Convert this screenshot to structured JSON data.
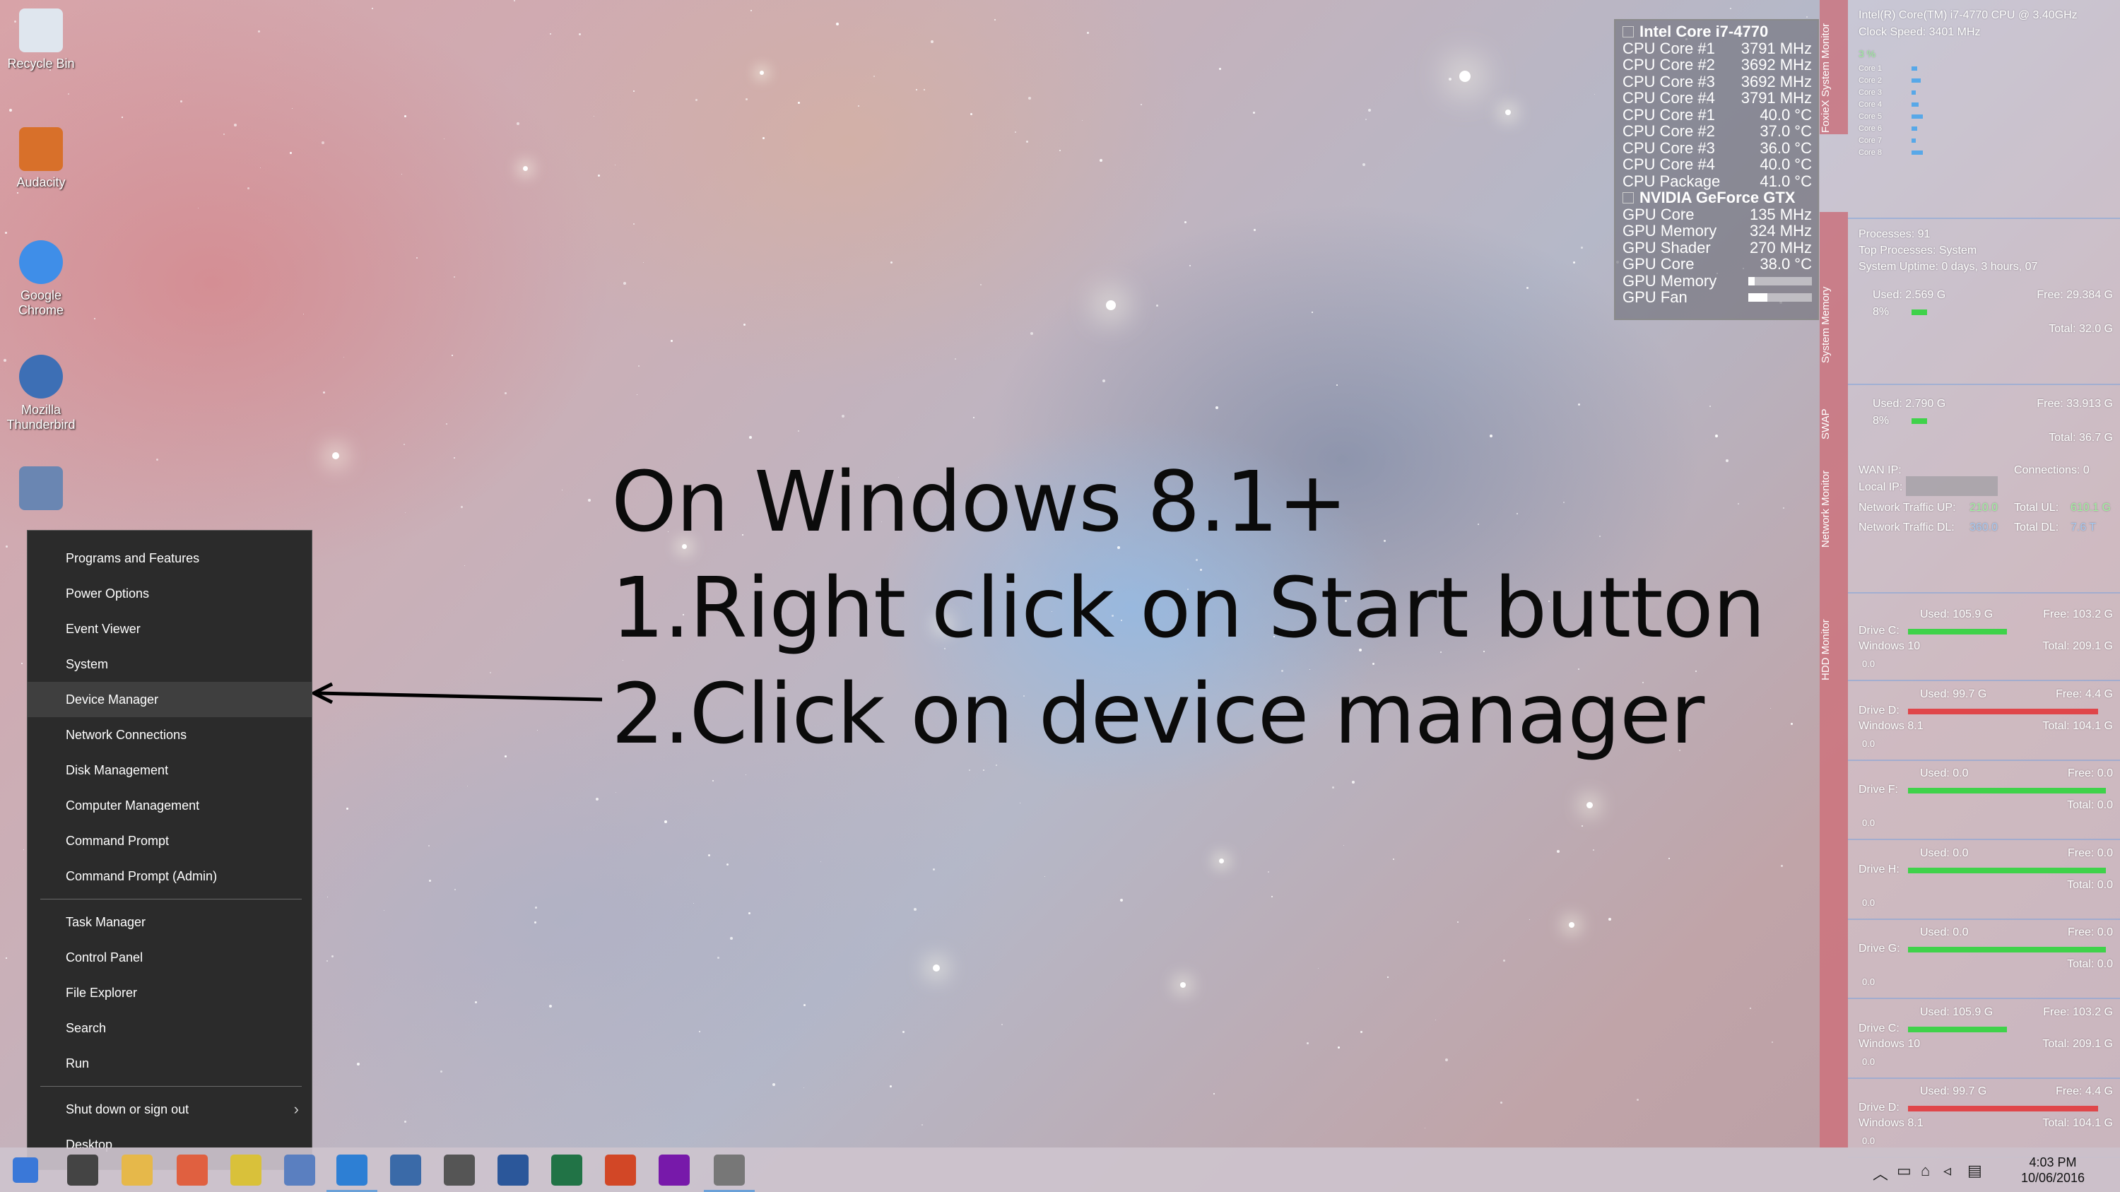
{
  "desktop_icons": [
    {
      "label": "Recycle Bin",
      "color": "#dfe6ee"
    },
    {
      "label": "Audacity",
      "color": "#d8702a"
    },
    {
      "label": "Google Chrome",
      "color": "#3f8ee8"
    },
    {
      "label": "Mozilla Thunderbird",
      "color": "#3d6fb5"
    },
    {
      "label": "",
      "color": "#6a86b2"
    }
  ],
  "instructions": {
    "line1": "On Windows 8.1+",
    "line2": "1.Right click on Start button",
    "line3": "2.Click on device manager"
  },
  "context_menu": {
    "group1": [
      "Programs and Features",
      "Power Options",
      "Event Viewer",
      "System",
      "Device Manager",
      "Network Connections",
      "Disk Management",
      "Computer Management",
      "Command Prompt",
      "Command Prompt (Admin)"
    ],
    "group2": [
      "Task Manager",
      "Control Panel",
      "File Explorer",
      "Search",
      "Run"
    ],
    "group3": {
      "shutdown": "Shut down or sign out",
      "chevron": "›",
      "desktop": "Desktop"
    },
    "highlighted": "Device Manager"
  },
  "gadget": {
    "cpu_title": "Intel Core i7-4770",
    "cpu_rows": [
      [
        "CPU Core #1",
        "3791 MHz"
      ],
      [
        "CPU Core #2",
        "3692 MHz"
      ],
      [
        "CPU Core #3",
        "3692 MHz"
      ],
      [
        "CPU Core #4",
        "3791 MHz"
      ],
      [
        "CPU Core #1",
        "40.0 °C"
      ],
      [
        "CPU Core #2",
        "37.0 °C"
      ],
      [
        "CPU Core #3",
        "36.0 °C"
      ],
      [
        "CPU Core #4",
        "40.0 °C"
      ],
      [
        "CPU Package",
        "41.0 °C"
      ]
    ],
    "gpu_title": "NVIDIA GeForce GTX",
    "gpu_rows": [
      [
        "GPU Core",
        "135 MHz"
      ],
      [
        "GPU Memory",
        "324 MHz"
      ],
      [
        "GPU Shader",
        "270 MHz"
      ],
      [
        "GPU Core",
        "38.0 °C"
      ]
    ],
    "gpu_bars": [
      {
        "label": "GPU Memory",
        "fill": 0.1
      },
      {
        "label": "GPU Fan",
        "fill": 0.3
      }
    ]
  },
  "monitor": {
    "cpu_name": "Intel(R) Core(TM) i7-4770 CPU @ 3.40GHz",
    "clock": "Clock Speed: 3401 MHz",
    "cpu_pct": "3 %",
    "cores": [
      {
        "label": "Core 1",
        "fill": 0.03
      },
      {
        "label": "Core 2",
        "fill": 0.05
      },
      {
        "label": "Core 3",
        "fill": 0.02
      },
      {
        "label": "Core 4",
        "fill": 0.04
      },
      {
        "label": "Core 5",
        "fill": 0.06
      },
      {
        "label": "Core 6",
        "fill": 0.03
      },
      {
        "label": "Core 7",
        "fill": 0.02
      },
      {
        "label": "Core 8",
        "fill": 0.06
      }
    ],
    "processes": "Processes: 91",
    "top_processes": "Top Processes: System",
    "uptime": "System Uptime: 0 days, 3 hours, 07",
    "section_labels": [
      "FoxieX System Monitor",
      "System Memory",
      "SWAP",
      "Network Monitor",
      "HDD Monitor"
    ],
    "memory": {
      "used": "Used: 2.569 G",
      "free": "Free: 29.384 G",
      "pct": "8%",
      "total": "Total: 32.0 G"
    },
    "swap": {
      "used": "Used: 2.790 G",
      "free": "Free: 33.913 G",
      "pct": "8%",
      "total": "Total: 36.7 G"
    },
    "network": {
      "wan": "WAN IP:",
      "connections": "Connections: 0",
      "local": "Local IP:",
      "up_label": "Network Traffic UP:",
      "up_val": "210.0",
      "total_ul_label": "Total UL:",
      "total_ul_val": "610.1 G",
      "dl_label": "Network Traffic DL:",
      "dl_val": "360.0",
      "total_dl_label": "Total DL:",
      "total_dl_val": "7.6 T"
    },
    "drives": [
      {
        "drive": "Drive C:",
        "name": "Windows 10",
        "used": "Used: 105.9 G",
        "free": "Free: 103.2 G",
        "total": "Total: 209.1 G",
        "zero": "0.0",
        "fill": 0.5,
        "color": "#3fd24a"
      },
      {
        "drive": "Drive D:",
        "name": "Windows 8.1",
        "used": "Used: 99.7 G",
        "free": "Free: 4.4 G",
        "total": "Total: 104.1 G",
        "zero": "0.0",
        "fill": 0.96,
        "color": "#e0464a"
      },
      {
        "drive": "Drive F:",
        "name": "",
        "used": "Used: 0.0",
        "free": "Free: 0.0",
        "total": "Total: 0.0",
        "zero": "0.0",
        "fill": 1.0,
        "color": "#3fd24a"
      },
      {
        "drive": "Drive H:",
        "name": "",
        "used": "Used: 0.0",
        "free": "Free: 0.0",
        "total": "Total: 0.0",
        "zero": "0.0",
        "fill": 1.0,
        "color": "#3fd24a"
      },
      {
        "drive": "Drive G:",
        "name": "",
        "used": "Used: 0.0",
        "free": "Free: 0.0",
        "total": "Total: 0.0",
        "zero": "0.0",
        "fill": 1.0,
        "color": "#3fd24a"
      },
      {
        "drive": "Drive C:",
        "name": "Windows 10",
        "used": "Used: 105.9 G",
        "free": "Free: 103.2 G",
        "total": "Total: 209.1 G",
        "zero": "0.0",
        "fill": 0.5,
        "color": "#3fd24a"
      },
      {
        "drive": "Drive D:",
        "name": "Windows 8.1",
        "used": "Used: 99.7 G",
        "free": "Free: 4.4 G",
        "total": "Total: 104.1 G",
        "zero": "0.0",
        "fill": 0.96,
        "color": "#e0464a"
      }
    ]
  },
  "taskbar": {
    "apps": [
      {
        "name": "start",
        "color": "#3a78d8"
      },
      {
        "name": "search",
        "color": "#444444"
      },
      {
        "name": "file-explorer",
        "color": "#e6b84a"
      },
      {
        "name": "store",
        "color": "#e06040"
      },
      {
        "name": "photos",
        "color": "#d9c13a"
      },
      {
        "name": "settings",
        "color": "#5a7fc0"
      },
      {
        "name": "internet-explorer",
        "color": "#2d7fd4"
      },
      {
        "name": "thunderbird",
        "color": "#3a6aa8"
      },
      {
        "name": "clock-app",
        "color": "#555555"
      },
      {
        "name": "word",
        "color": "#2b579a"
      },
      {
        "name": "excel",
        "color": "#217346"
      },
      {
        "name": "powerpoint",
        "color": "#d24726"
      },
      {
        "name": "onenote",
        "color": "#7719aa"
      },
      {
        "name": "printer",
        "color": "#777777"
      }
    ],
    "time": "4:03 PM",
    "date": "10/06/2016"
  }
}
